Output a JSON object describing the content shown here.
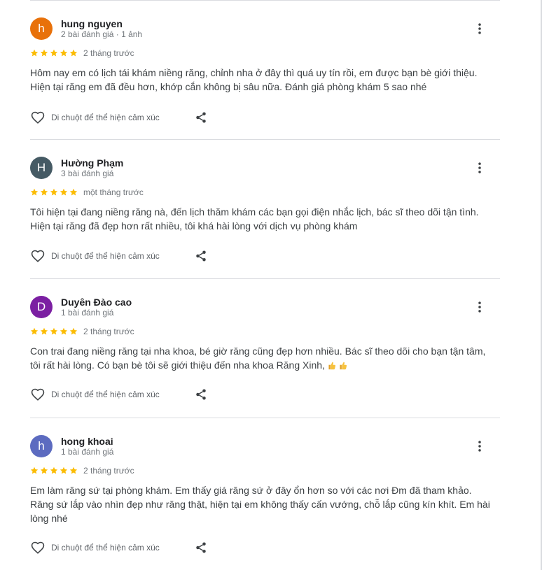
{
  "action_label": "Di chuột để thể hiện cảm xúc",
  "colors": {
    "star": "#fbbc04",
    "divider": "#dadce0",
    "meta_text": "#70757a",
    "body_text": "#3c4043"
  },
  "icons": {
    "star": "star-icon",
    "more": "more-vert-icon",
    "react": "heart-outline-icon",
    "share": "share-icon",
    "thumb": "thumbs-up-emoji"
  },
  "reviews": [
    {
      "initial": "h",
      "avatar_color": "#e8710a",
      "name": "hung nguyen",
      "meta": "2 bài đánh giá · 1 ảnh",
      "rating": 5,
      "time": "2 tháng trước",
      "text": "Hôm nay em có lịch tái khám niềng răng, chỉnh nha ở đây thì quá uy tín rồi, em được bạn bè giới thiệu. Hiện tại răng em đã đều hơn, khớp cắn không bị sâu nữa. Đánh giá phòng khám 5 sao nhé"
    },
    {
      "initial": "H",
      "avatar_color": "#455a64",
      "name": "Hường Phạm",
      "meta": "3 bài đánh giá",
      "rating": 5,
      "time": "một tháng trước",
      "text": "Tôi hiện tại đang niềng răng nà, đến lịch thăm khám các bạn gọi điện nhắc lịch, bác sĩ theo dõi tận tình. Hiện tại răng đã đẹp hơn rất nhiều, tôi khá hài lòng với dịch vụ phòng khám"
    },
    {
      "initial": "D",
      "avatar_color": "#7b1fa2",
      "name": "Duyên Đào cao",
      "meta": "1 bài đánh giá",
      "rating": 5,
      "time": "2 tháng trước",
      "text": "Con trai đang niềng răng tại nha khoa, bé giờ răng cũng đẹp hơn nhiều. Bác sĩ theo dõi cho bạn tận tâm, tôi rất hài lòng. Có bạn bè tôi sẽ giới thiệu đến nha khoa Răng Xinh,"
    },
    {
      "initial": "h",
      "avatar_color": "#5c6bc0",
      "name": "hong khoai",
      "meta": "1 bài đánh giá",
      "rating": 5,
      "time": "2 tháng trước",
      "text": "Em làm răng sứ tại phòng khám. Em thấy giá răng sứ ở đây ổn hơn so với các nơi Đm đã tham khảo. Răng sứ lắp vào nhìn đẹp như răng thật, hiện tại em không thấy cấn vướng, chỗ lắp cũng kín khít. Em hài lòng nhé"
    }
  ]
}
